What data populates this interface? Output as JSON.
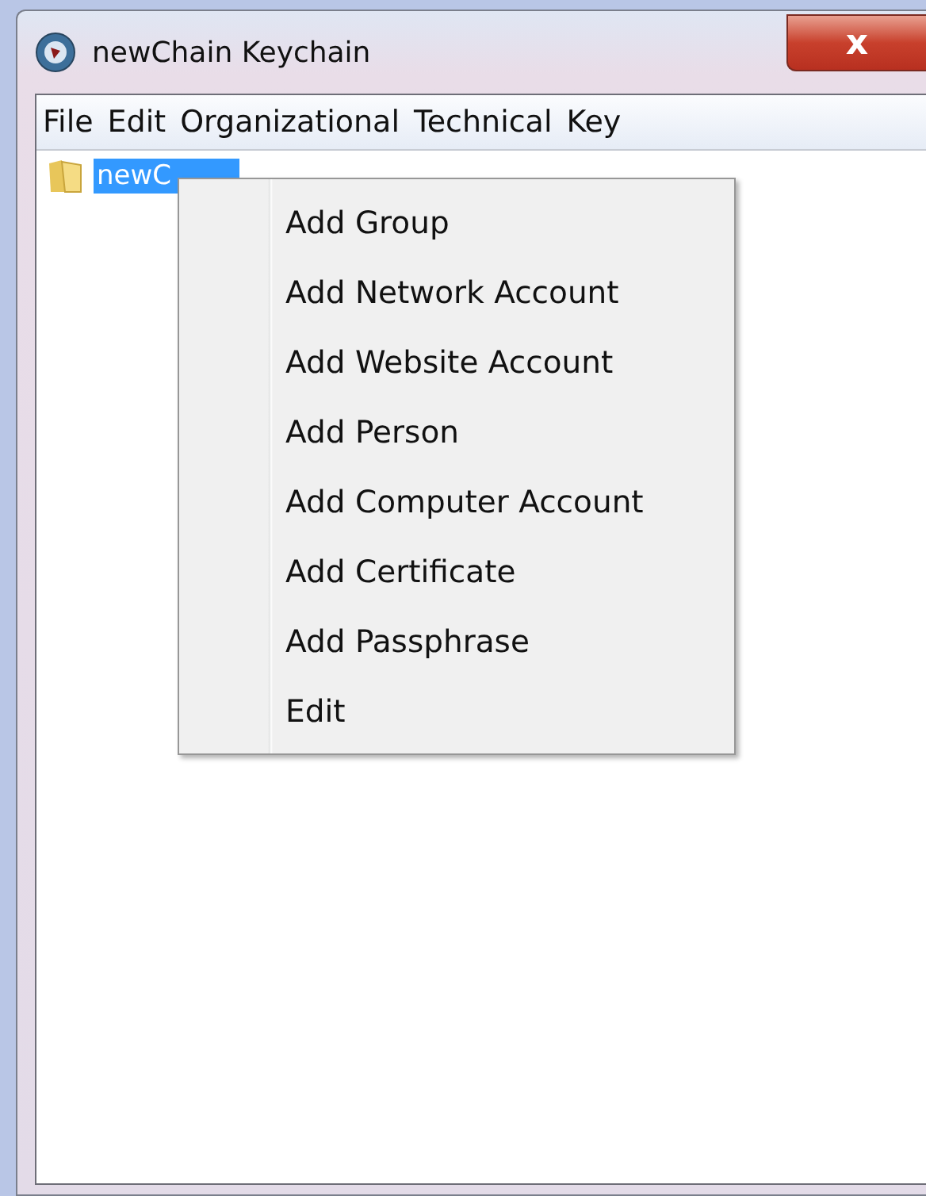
{
  "window": {
    "title": "newChain Keychain",
    "close": "x"
  },
  "menu_bar": [
    "File",
    "Edit",
    "Organizational",
    "Technical",
    "Key"
  ],
  "tree": {
    "items": [
      {
        "label": "newC",
        "selected": true
      }
    ]
  },
  "context_menu": {
    "items": [
      "Add Group",
      "Add Network Account",
      "Add Website Account",
      "Add Person",
      "Add Computer Account",
      "Add Certificate",
      "Add Passphrase",
      "Edit"
    ]
  }
}
